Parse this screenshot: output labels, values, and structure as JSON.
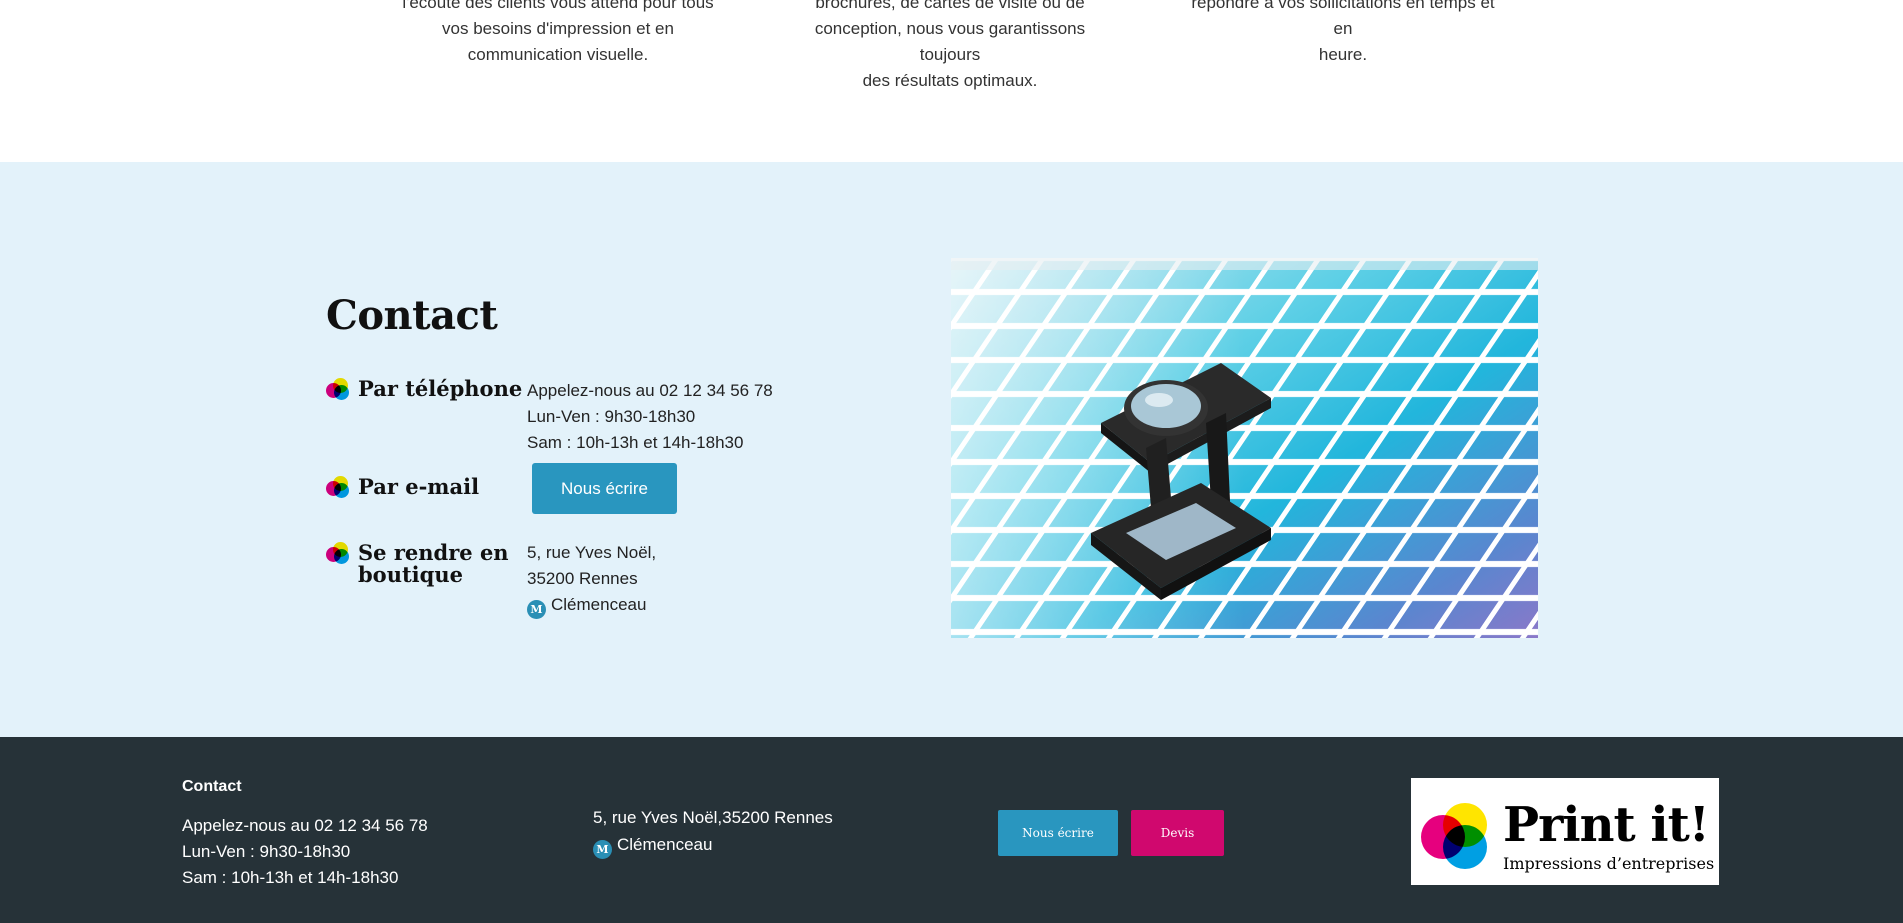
{
  "features": [
    {
      "lines": [
        "l'écoute des clients vous attend pour tous",
        "vos besoins d'impression et en",
        "communication visuelle."
      ]
    },
    {
      "lines": [
        "brochures, de cartes de visite ou de",
        "conception, nous vous garantissons toujours",
        "des résultats optimaux."
      ]
    },
    {
      "lines": [
        "répondre à vos sollicitations en temps et en",
        "heure."
      ]
    }
  ],
  "contact": {
    "title": "Contact",
    "phone": {
      "label": "Par téléphone",
      "lines": [
        "Appelez-nous au 02 12 34 56 78",
        "Lun-Ven : 9h30-18h30",
        "Sam : 10h-13h et 14h-18h30"
      ]
    },
    "email": {
      "label": "Par e-mail",
      "button": "Nous écrire"
    },
    "shop": {
      "label_line1": "Se rendre en",
      "label_line2": "boutique",
      "street": "5, rue Yves Noël,",
      "city": "35200 Rennes",
      "metro_letter": "M",
      "metro_station": "Clémenceau"
    }
  },
  "footer": {
    "title": "Contact",
    "lines": [
      "Appelez-nous au 02 12 34 56 78",
      "Lun-Ven : 9h30-18h30",
      "Sam : 10h-13h et 14h-18h30"
    ],
    "address": "5, rue Yves Noël,35200 Rennes",
    "metro_letter": "M",
    "metro_station": "Clémenceau",
    "btn_write": "Nous écrire",
    "btn_quote": "Devis"
  },
  "logo": {
    "name": "Print it!",
    "tagline": "Impressions d’entreprises"
  },
  "colors": {
    "accent_blue": "#2996bf",
    "accent_magenta": "#d0086e",
    "contact_bg": "#e3f2fa",
    "footer_bg": "#263238"
  },
  "icons": [
    "cmyk-bullet-icon",
    "metro-icon",
    "loupe-photo",
    "print-it-logo"
  ]
}
